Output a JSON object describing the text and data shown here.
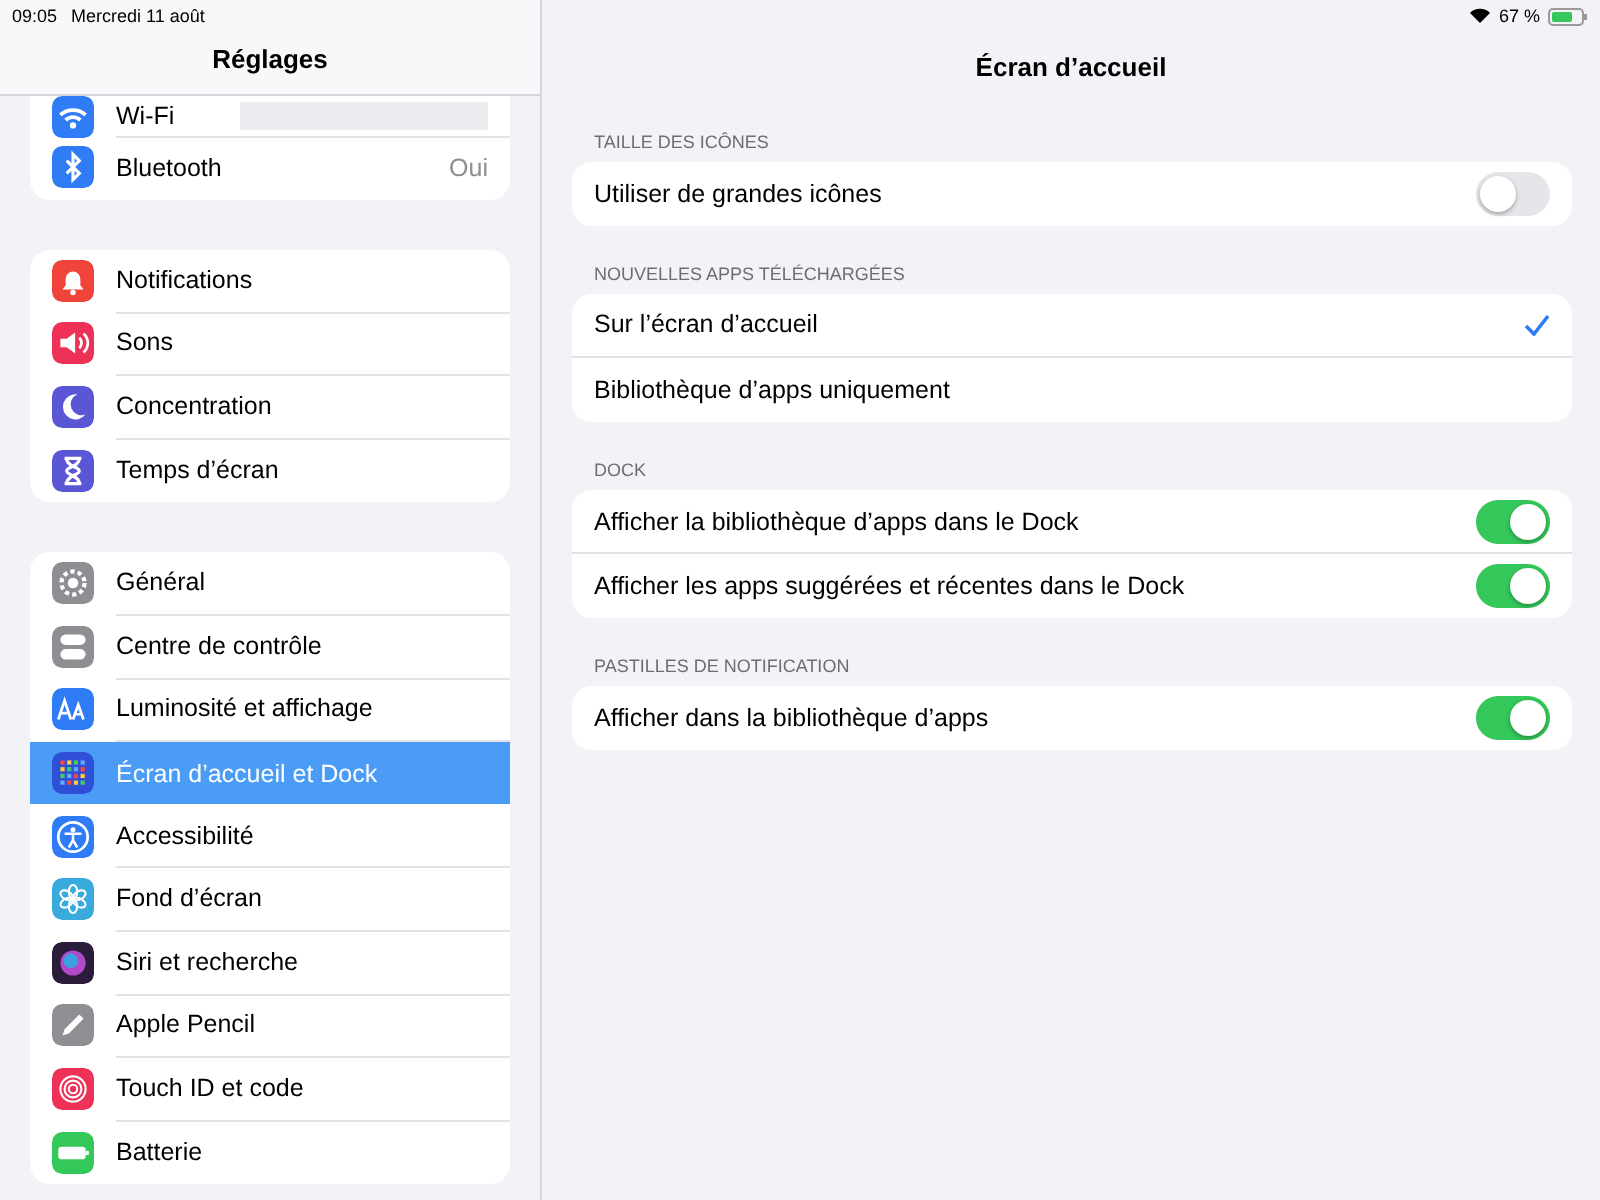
{
  "status_bar": {
    "time": "09:05",
    "date": "Mercredi 11 août",
    "battery": "67 %"
  },
  "sidebar": {
    "title": "Réglages",
    "groups": [
      {
        "items": [
          {
            "label": "Wi-Fi",
            "kind": "wifi",
            "color": "#2f7cf6",
            "selected": false,
            "redacted": true
          },
          {
            "label": "Bluetooth",
            "kind": "bluetooth",
            "color": "#2f7cf6",
            "selected": false,
            "value": "Oui"
          }
        ]
      },
      {
        "items": [
          {
            "label": "Notifications",
            "kind": "bell",
            "color": "#f0443a",
            "selected": false
          },
          {
            "label": "Sons",
            "kind": "speaker",
            "color": "#ee3157",
            "selected": false
          },
          {
            "label": "Concentration",
            "kind": "moon",
            "color": "#5b56d6",
            "selected": false
          },
          {
            "label": "Temps d’écran",
            "kind": "hourglass",
            "color": "#5b56d6",
            "selected": false
          }
        ]
      },
      {
        "items": [
          {
            "label": "Général",
            "kind": "gear",
            "color": "#8e8e93",
            "selected": false
          },
          {
            "label": "Centre de contrôle",
            "kind": "switches",
            "color": "#8e8e93",
            "selected": false
          },
          {
            "label": "Luminosité et affichage",
            "kind": "text",
            "color": "#2f7cf6",
            "selected": false
          },
          {
            "label": "Écran d’accueil et Dock",
            "kind": "grid",
            "color": "#2f4fd6",
            "selected": true
          },
          {
            "label": "Accessibilité",
            "kind": "person",
            "color": "#2f7cf6",
            "selected": false
          },
          {
            "label": "Fond d’écran",
            "kind": "flower",
            "color": "#38aadc",
            "selected": false
          },
          {
            "label": "Siri et recherche",
            "kind": "orb",
            "color": "#2a1c3a",
            "selected": false
          },
          {
            "label": "Apple Pencil",
            "kind": "pencil",
            "color": "#8e8e93",
            "selected": false
          },
          {
            "label": "Touch ID et code",
            "kind": "fingerprint",
            "color": "#ee3157",
            "selected": false
          },
          {
            "label": "Batterie",
            "kind": "battery",
            "color": "#34c759",
            "selected": false
          }
        ]
      }
    ]
  },
  "detail": {
    "title": "Écran d’accueil",
    "sections": [
      {
        "header": "TAILLE DES ICÔNES",
        "rows": [
          {
            "kind": "toggle",
            "label": "Utiliser de grandes icônes",
            "on": false
          }
        ]
      },
      {
        "header": "NOUVELLES APPS TÉLÉCHARGÉES",
        "rows": [
          {
            "kind": "choice",
            "label": "Sur l’écran d’accueil",
            "selected": true
          },
          {
            "kind": "choice",
            "label": "Bibliothèque d’apps uniquement",
            "selected": false
          }
        ]
      },
      {
        "header": "DOCK",
        "rows": [
          {
            "kind": "toggle",
            "label": "Afficher la bibliothèque d’apps dans le Dock",
            "on": true
          },
          {
            "kind": "toggle",
            "label": "Afficher les apps suggérées et récentes dans le Dock",
            "on": true
          }
        ]
      },
      {
        "header": "PASTILLES DE NOTIFICATION",
        "rows": [
          {
            "kind": "toggle",
            "label": "Afficher dans la bibliothèque d’apps",
            "on": true
          }
        ]
      }
    ]
  }
}
